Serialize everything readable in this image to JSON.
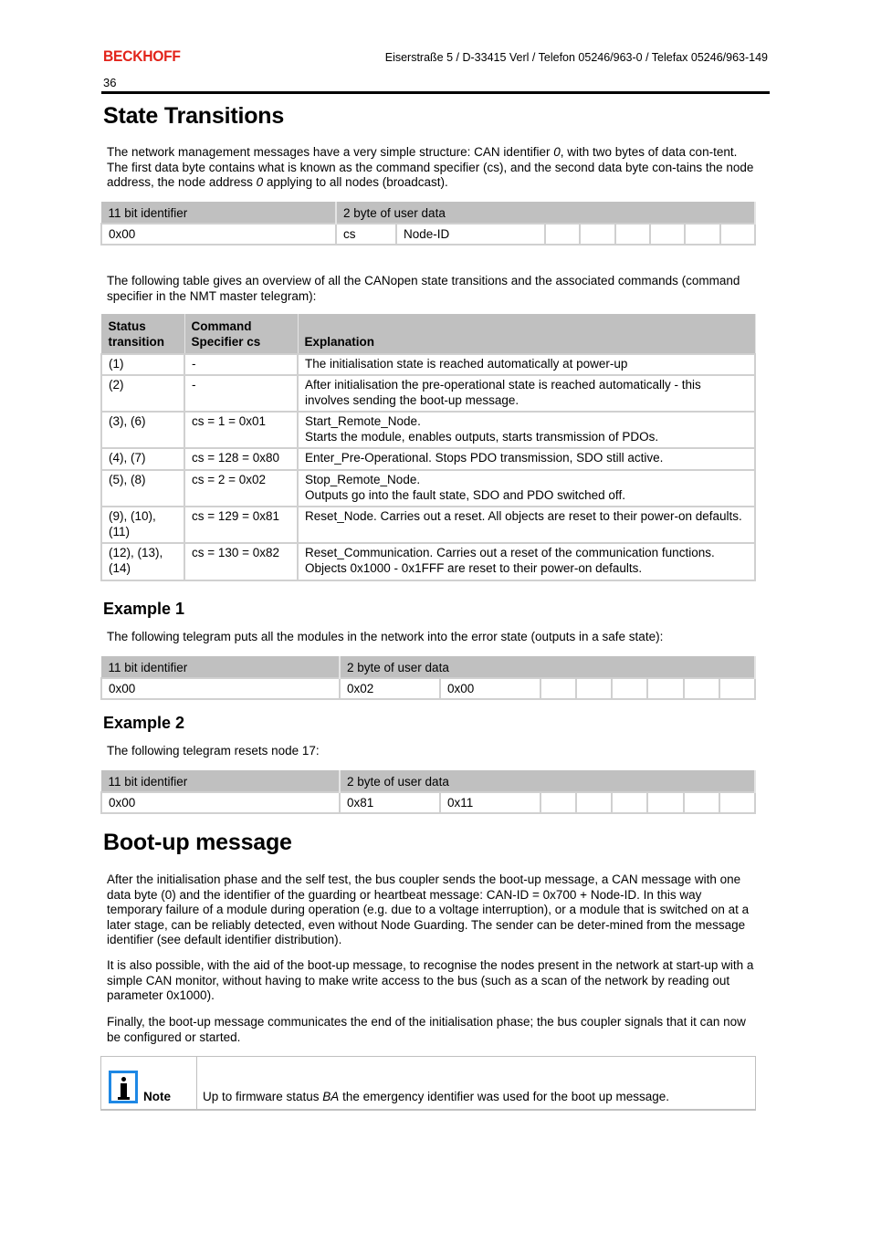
{
  "header": {
    "logo": "BECKHOFF",
    "address": "Eiserstraße 5 / D-33415 Verl / Telefon 05246/963-0 / Telefax 05246/963-149",
    "page_number": "36",
    "brand_color": "#e2231a"
  },
  "section1": {
    "title": "State Transitions",
    "intro": {
      "part1": "The network management messages have a very simple structure: CAN identifier ",
      "italic1": "0",
      "part2": ", with two bytes of data con-tent. The first data byte contains what is known as the command specifier (cs), and the second data byte con-tains the node address, the node address ",
      "italic2": "0",
      "part3": " applying to all nodes (broadcast)."
    },
    "telegram": {
      "headers": [
        "11 bit identifier",
        "2 byte of user data"
      ],
      "row": [
        "0x00",
        "cs",
        "Node-ID",
        "",
        "",
        "",
        "",
        "",
        ""
      ]
    },
    "overview_text": "The following table gives an overview of all the CANopen state transitions and the associated commands (command specifier in the NMT master telegram):",
    "transitions_table": {
      "headers": [
        "Status transition",
        "Command Specifier cs",
        "Explanation"
      ],
      "rows": [
        {
          "status": "(1)",
          "cs": "-",
          "explanation": [
            "The initialisation state is reached automatically at power-up"
          ]
        },
        {
          "status": "(2)",
          "cs": "-",
          "explanation": [
            "After initialisation the pre-operational state is reached automatically - this involves sending the boot-up message."
          ]
        },
        {
          "status": "(3), (6)",
          "cs": "cs = 1 = 0x01",
          "explanation": [
            "Start_Remote_Node.",
            "Starts the module, enables outputs, starts transmission of PDOs."
          ]
        },
        {
          "status": "(4), (7)",
          "cs": "cs = 128 = 0x80",
          "explanation": [
            "Enter_Pre-Operational. Stops PDO transmission, SDO still active."
          ]
        },
        {
          "status": "(5), (8)",
          "cs": "cs = 2 = 0x02",
          "explanation": [
            "Stop_Remote_Node.",
            "Outputs go into the fault state, SDO and PDO switched off."
          ]
        },
        {
          "status": "(9), (10), (11)",
          "cs": "cs = 129 = 0x81",
          "explanation": [
            "Reset_Node. Carries out a reset. All objects are reset to their power-on defaults."
          ]
        },
        {
          "status": "(12), (13), (14)",
          "cs": "cs = 130 = 0x82",
          "explanation": [
            "Reset_Communication. Carries out a reset of the communication functions.",
            "Objects 0x1000 - 0x1FFF are reset to their power-on defaults."
          ]
        }
      ]
    }
  },
  "example1": {
    "title": "Example 1",
    "text": "The following telegram puts all the modules in the network into the error state (outputs in a safe state):",
    "telegram": {
      "headers": [
        "11 bit identifier",
        "2 byte of user data"
      ],
      "row": [
        "0x00",
        "0x02",
        "0x00",
        "",
        "",
        "",
        "",
        "",
        ""
      ]
    }
  },
  "example2": {
    "title": "Example 2",
    "text": "The following telegram resets node 17:",
    "telegram": {
      "headers": [
        "11 bit identifier",
        "2 byte of user data"
      ],
      "row": [
        "0x00",
        "0x81",
        "0x11",
        "",
        "",
        "",
        "",
        "",
        ""
      ]
    }
  },
  "section2": {
    "title": "Boot-up message",
    "paragraphs": [
      "After the initialisation phase and the self test, the bus coupler sends the boot-up message, a CAN message with one data byte (0) and the identifier of the guarding or heartbeat message: CAN-ID = 0x700 + Node-ID. In this way temporary failure of a module during operation (e.g. due to a voltage interruption), or a module that is switched on at a later stage, can be reliably detected, even without Node Guarding. The sender can be deter-mined from the message identifier (see default identifier distribution).",
      "It is also possible, with the aid of the boot-up message, to recognise the nodes present in the network at start-up with a simple CAN monitor, without having to make write access to the bus (such as a scan of the network by reading out parameter 0x1000).",
      "Finally, the boot-up message communicates the end of the initialisation phase; the bus coupler signals that it can now be configured or started."
    ],
    "note": {
      "icon": "info-icon",
      "label": "Note",
      "text_before": "Up to firmware status ",
      "text_italic": "BA",
      "text_after": " the emergency identifier was used for the boot up message."
    }
  }
}
